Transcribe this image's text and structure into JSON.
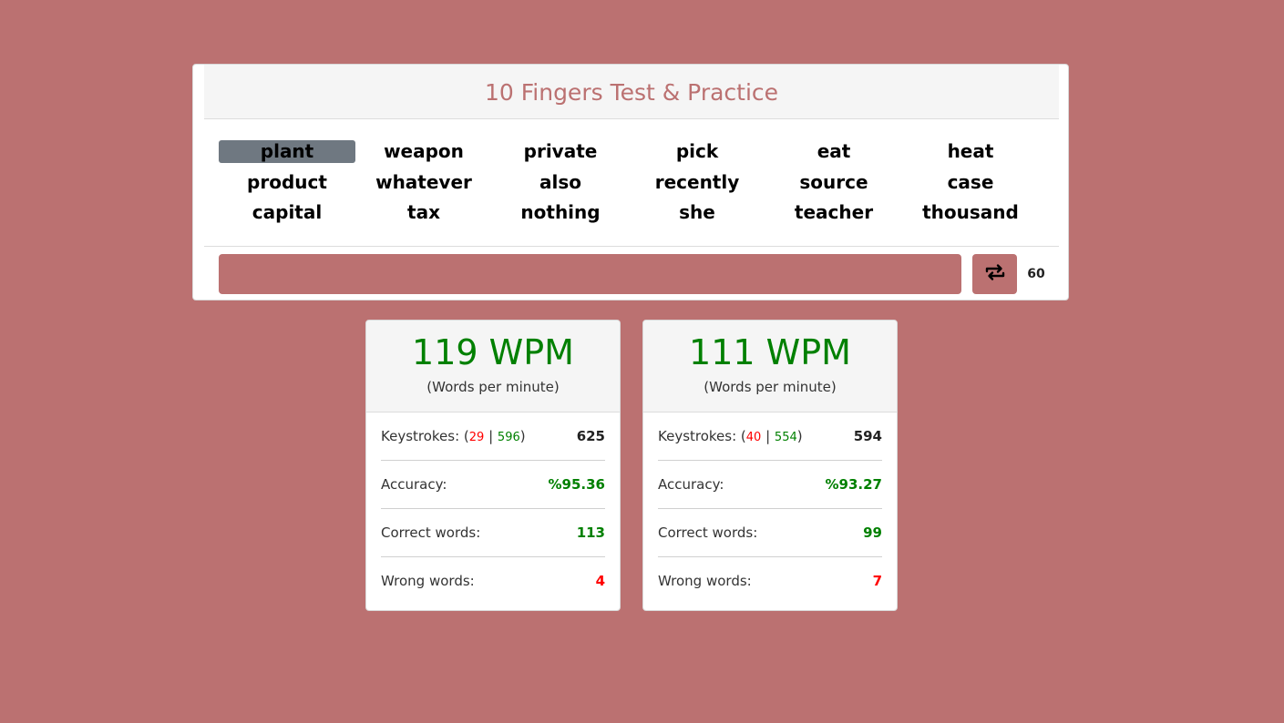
{
  "app": {
    "title": "10 Fingers Test & Practice"
  },
  "words": [
    [
      "plant",
      "weapon",
      "private",
      "pick",
      "eat",
      "heat"
    ],
    [
      "product",
      "whatever",
      "also",
      "recently",
      "source",
      "case"
    ],
    [
      "capital",
      "tax",
      "nothing",
      "she",
      "teacher",
      "thousand"
    ]
  ],
  "current_word_index": 0,
  "input": {
    "value": "",
    "placeholder": ""
  },
  "controls": {
    "refresh_icon": "repeat-icon",
    "timer": "60"
  },
  "results": [
    {
      "wpm": "119 WPM",
      "wpm_sub": "(Words per minute)",
      "keystrokes_label": "Keystrokes:",
      "keystrokes_wrong": "29",
      "keystrokes_correct": "596",
      "keystrokes_total": "625",
      "accuracy_label": "Accuracy:",
      "accuracy_value": "%95.36",
      "correct_label": "Correct words:",
      "correct_value": "113",
      "wrong_label": "Wrong words:",
      "wrong_value": "4"
    },
    {
      "wpm": "111 WPM",
      "wpm_sub": "(Words per minute)",
      "keystrokes_label": "Keystrokes:",
      "keystrokes_wrong": "40",
      "keystrokes_correct": "554",
      "keystrokes_total": "594",
      "accuracy_label": "Accuracy:",
      "accuracy_value": "%93.27",
      "correct_label": "Correct words:",
      "correct_value": "99",
      "wrong_label": "Wrong words:",
      "wrong_value": "7"
    }
  ],
  "colors": {
    "background": "#bb7171",
    "accent_green": "#008000",
    "accent_red": "#ff0000",
    "current_word_highlight": "#6f7881"
  }
}
